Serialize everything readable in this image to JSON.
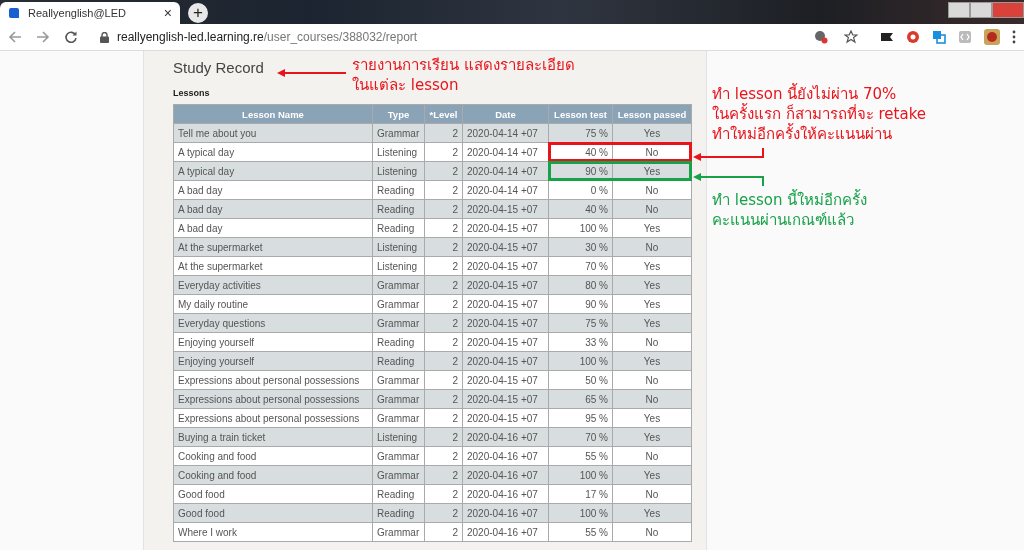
{
  "browser": {
    "tab_title": "Reallyenglish@LED",
    "close_mark": "×",
    "new_tab_mark": "+",
    "url_host": "reallyenglish-led.learning.re",
    "url_path": "/user_courses/388032/report"
  },
  "page": {
    "title": "Study Record",
    "section": "Lessons"
  },
  "table": {
    "columns": [
      "Lesson Name",
      "Type",
      "*Level",
      "Date",
      "Lesson test",
      "Lesson passed"
    ],
    "rows": [
      {
        "cells": [
          "Tell me about you",
          "Grammar",
          "2",
          "2020-04-14 +07",
          "75 %",
          "Yes"
        ]
      },
      {
        "cells": [
          "A typical day",
          "Listening",
          "2",
          "2020-04-14 +07",
          "40 %",
          "No"
        ],
        "color": "#e8141c"
      },
      {
        "cells": [
          "A typical day",
          "Listening",
          "2",
          "2020-04-14 +07",
          "90 %",
          "Yes"
        ],
        "color": "#17a24a"
      },
      {
        "cells": [
          "A bad day",
          "Reading",
          "2",
          "2020-04-14 +07",
          "0 %",
          "No"
        ]
      },
      {
        "cells": [
          "A bad day",
          "Reading",
          "2",
          "2020-04-15 +07",
          "40 %",
          "No"
        ]
      },
      {
        "cells": [
          "A bad day",
          "Reading",
          "2",
          "2020-04-15 +07",
          "100 %",
          "Yes"
        ]
      },
      {
        "cells": [
          "At the supermarket",
          "Listening",
          "2",
          "2020-04-15 +07",
          "30 %",
          "No"
        ]
      },
      {
        "cells": [
          "At the supermarket",
          "Listening",
          "2",
          "2020-04-15 +07",
          "70 %",
          "Yes"
        ]
      },
      {
        "cells": [
          "Everyday activities",
          "Grammar",
          "2",
          "2020-04-15 +07",
          "80 %",
          "Yes"
        ]
      },
      {
        "cells": [
          "My daily routine",
          "Grammar",
          "2",
          "2020-04-15 +07",
          "90 %",
          "Yes"
        ]
      },
      {
        "cells": [
          "Everyday questions",
          "Grammar",
          "2",
          "2020-04-15 +07",
          "75 %",
          "Yes"
        ]
      },
      {
        "cells": [
          "Enjoying yourself",
          "Reading",
          "2",
          "2020-04-15 +07",
          "33 %",
          "No"
        ]
      },
      {
        "cells": [
          "Enjoying yourself",
          "Reading",
          "2",
          "2020-04-15 +07",
          "100 %",
          "Yes"
        ]
      },
      {
        "cells": [
          "Expressions about personal possessions",
          "Grammar",
          "2",
          "2020-04-15 +07",
          "50 %",
          "No"
        ]
      },
      {
        "cells": [
          "Expressions about personal possessions",
          "Grammar",
          "2",
          "2020-04-15 +07",
          "65 %",
          "No"
        ]
      },
      {
        "cells": [
          "Expressions about personal possessions",
          "Grammar",
          "2",
          "2020-04-15 +07",
          "95 %",
          "Yes"
        ]
      },
      {
        "cells": [
          "Buying a train ticket",
          "Listening",
          "2",
          "2020-04-16 +07",
          "70 %",
          "Yes"
        ]
      },
      {
        "cells": [
          "Cooking and food",
          "Grammar",
          "2",
          "2020-04-16 +07",
          "55 %",
          "No"
        ]
      },
      {
        "cells": [
          "Cooking and food",
          "Grammar",
          "2",
          "2020-04-16 +07",
          "100 %",
          "Yes"
        ]
      },
      {
        "cells": [
          "Good food",
          "Reading",
          "2",
          "2020-04-16 +07",
          "17 %",
          "No"
        ]
      },
      {
        "cells": [
          "Good food",
          "Reading",
          "2",
          "2020-04-16 +07",
          "100 %",
          "Yes"
        ]
      },
      {
        "cells": [
          "Where I work",
          "Grammar",
          "2",
          "2020-04-16 +07",
          "55 %",
          "No"
        ]
      }
    ]
  },
  "annotations": [
    {
      "kind": "title",
      "color": "#e8141c",
      "lines": [
        "รายงานการเรียน แสดงรายละเอียด",
        "ในแต่ละ lesson"
      ]
    },
    {
      "kind": "fail",
      "color": "#e8141c",
      "lines": [
        "ทำ lesson นี้ยังไม่ผ่าน 70%",
        "ในครั้งแรก ก็สามารถที่จะ retake",
        "ทำใหม่อีกครั้งให้คะแนนผ่าน"
      ]
    },
    {
      "kind": "pass",
      "color": "#17a24a",
      "lines": [
        "ทำ lesson นี้ใหม่อีกครั้ง",
        "คะแนนผ่านเกณฑ์แล้ว"
      ]
    }
  ]
}
